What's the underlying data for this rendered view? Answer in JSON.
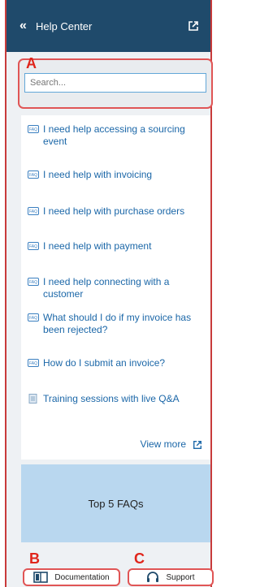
{
  "header": {
    "back_glyph": "«",
    "title": "Help Center",
    "external_icon": "external-link-icon"
  },
  "annotations": {
    "a": "A",
    "b": "B",
    "c": "C"
  },
  "search": {
    "placeholder": "Search..."
  },
  "faq_items": [
    {
      "label": "I need help accessing a sourcing event",
      "icon": "faq-icon"
    },
    {
      "label": "I need help with invoicing",
      "icon": "faq-icon"
    },
    {
      "label": "I need help with purchase orders",
      "icon": "faq-icon"
    },
    {
      "label": "I need help with payment",
      "icon": "faq-icon"
    },
    {
      "label": "I need help connecting with a customer",
      "icon": "faq-icon"
    },
    {
      "label": "What should I do if my invoice has been rejected?",
      "icon": "faq-icon"
    },
    {
      "label": "How do I submit an invoice?",
      "icon": "faq-icon"
    },
    {
      "label": "Training sessions with live Q&A",
      "icon": "document-icon"
    }
  ],
  "view_more": "View more",
  "top_faqs": "Top 5 FAQs",
  "footer": {
    "documentation": "Documentation",
    "support": "Support"
  },
  "colors": {
    "header_bg": "#1f4a6b",
    "link": "#1b67a8",
    "annotation": "#e0251b",
    "faq_box": "#b9d7ef"
  }
}
